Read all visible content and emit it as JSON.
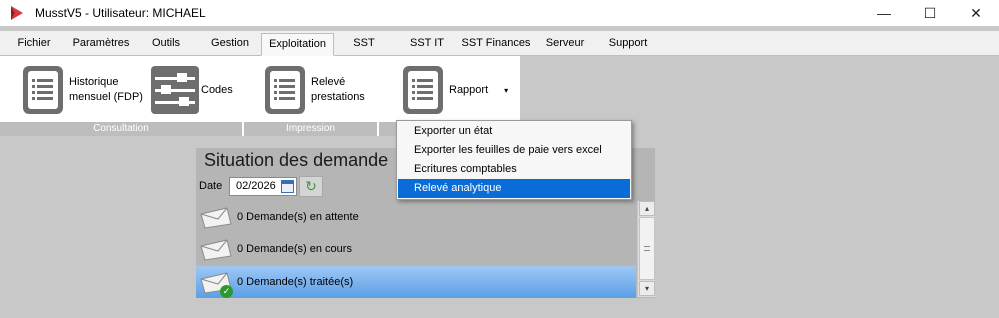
{
  "window": {
    "title": "MusstV5 - Utilisateur: MICHAEL",
    "minimize_symbol": "—",
    "maximize_symbol": "☐",
    "close_symbol": "✕"
  },
  "menu": {
    "tabs": [
      {
        "label": "Fichier"
      },
      {
        "label": "Paramètres"
      },
      {
        "label": "Outils"
      },
      {
        "label": "Gestion"
      },
      {
        "label": "Exploitation"
      },
      {
        "label": "SST"
      },
      {
        "label": "SST IT"
      },
      {
        "label": "SST Finances"
      },
      {
        "label": "Serveur"
      },
      {
        "label": "Support"
      }
    ],
    "active_tab": "Exploitation"
  },
  "ribbon": {
    "items": [
      {
        "label_line1": "Historique",
        "label_line2": "mensuel (FDP)",
        "icon": "document-list-icon"
      },
      {
        "label": "Codes",
        "icon": "sliders-icon"
      },
      {
        "label_line1": "Relevé",
        "label_line2": "prestations",
        "icon": "document-list-icon"
      },
      {
        "label": "Rapport",
        "icon": "document-list-icon",
        "arrow": "▾"
      }
    ],
    "groups": [
      {
        "label": "Consultation"
      },
      {
        "label": "Impression"
      }
    ]
  },
  "rapport_menu": {
    "items": [
      {
        "label": "Exporter un état"
      },
      {
        "label": "Exporter les feuilles de paie vers excel"
      },
      {
        "label": "Ecritures comptables"
      },
      {
        "label": "Relevé analytique"
      }
    ],
    "highlighted": "Relevé analytique"
  },
  "situation": {
    "title": "Situation des demande",
    "date_label": "Date",
    "date_value": "02/2026",
    "refresh_symbol": "↻",
    "rows": [
      {
        "label": "0 Demande(s) en attente",
        "icon": "envelope-icon"
      },
      {
        "label": "0 Demande(s) en cours",
        "icon": "envelope-icon"
      },
      {
        "label": "0 Demande(s) traitée(s)",
        "icon": "envelope-check-icon"
      }
    ],
    "selected_row": "0 Demande(s) traitée(s)",
    "scroll_up_symbol": "▴",
    "scroll_down_symbol": "▾"
  },
  "colors": {
    "highlight": "#0a6cd6",
    "selected_row": "#5b9fe6",
    "app_logo": "#d9363e"
  }
}
